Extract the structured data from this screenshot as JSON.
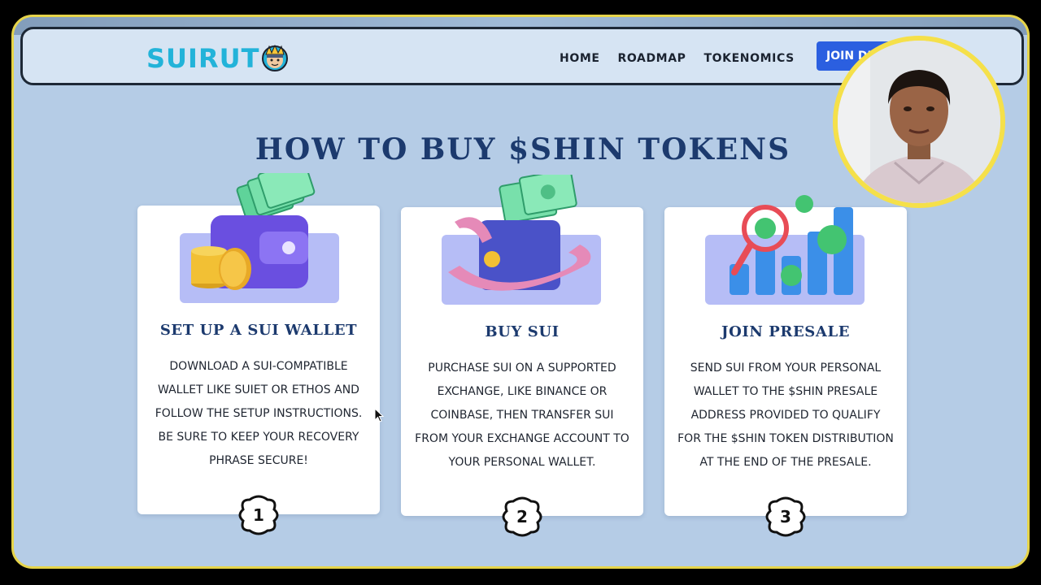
{
  "colors": {
    "page_bg": "#b5cce6",
    "frame_border": "#e6d44a",
    "navbar_bg": "#d6e4f3",
    "brand_cyan": "#22b3d9",
    "title_navy": "#1c3a6e",
    "button_blue": "#2b5fe0",
    "webcam_ring": "#f5e04a"
  },
  "navbar": {
    "logo_text": "SUIRUT",
    "logo_icon": "ninja-face-icon",
    "links": [
      "HOME",
      "ROADMAP",
      "TOKENOMICS"
    ],
    "join_button": "JOIN DISCORD"
  },
  "section": {
    "title": "HOW TO BUY $SHIN TOKENS"
  },
  "cards": [
    {
      "icon": "wallet-coins-icon",
      "title": "SET UP A SUI WALLET",
      "body": "DOWNLOAD A SUI-COMPATIBLE WALLET LIKE SUIET OR ETHOS AND FOLLOW THE SETUP INSTRUCTIONS. BE SURE TO KEEP YOUR RECOVERY PHRASE SECURE!",
      "step": "1"
    },
    {
      "icon": "magnet-cash-icon",
      "title": "BUY SUI",
      "body": "PURCHASE SUI ON A SUPPORTED EXCHANGE, LIKE BINANCE OR COINBASE, THEN TRANSFER SUI FROM YOUR EXCHANGE ACCOUNT TO YOUR PERSONAL WALLET.",
      "step": "2"
    },
    {
      "icon": "growth-chart-icon",
      "title": "JOIN PRESALE",
      "body": "SEND SUI FROM YOUR PERSONAL WALLET TO THE $SHIN PRESALE ADDRESS PROVIDED TO QUALIFY FOR THE $SHIN TOKEN DISTRIBUTION AT THE END OF THE PRESALE.",
      "step": "3"
    }
  ],
  "overlay": {
    "webcam": "presenter-webcam"
  }
}
